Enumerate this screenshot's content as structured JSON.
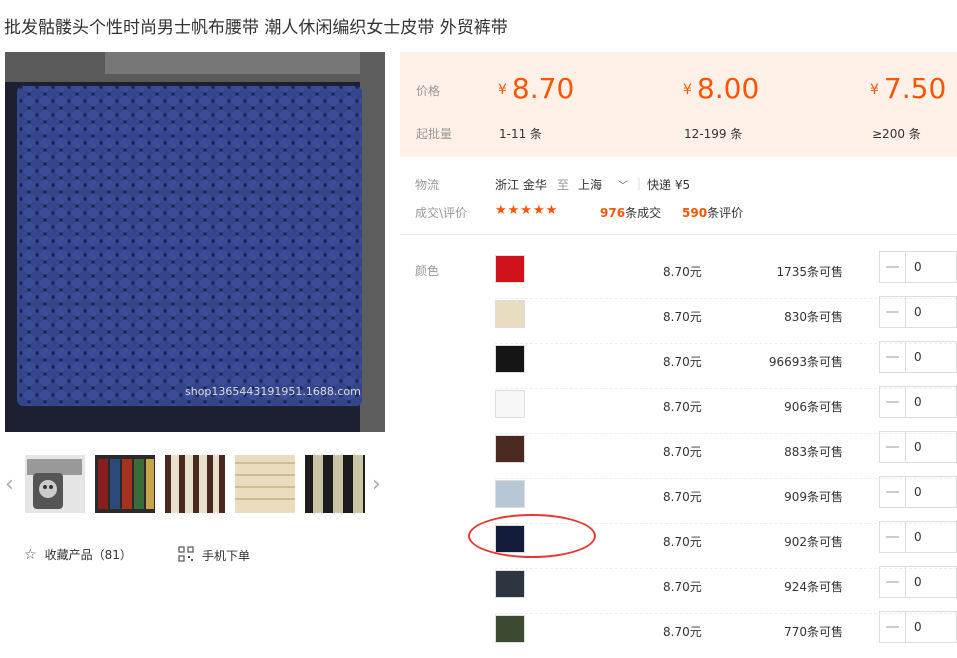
{
  "title": "批发骷髅头个性时尚男士帆布腰带 潮人休闲编织女士皮带 外贸裤带",
  "main_image": {
    "watermark": "shop1365443191951.1688.com"
  },
  "thumbnails": [
    {
      "name": "skull-buckle"
    },
    {
      "name": "stripe-samples"
    },
    {
      "name": "brown-stripe"
    },
    {
      "name": "beige-canvas"
    },
    {
      "name": "black-stripe"
    }
  ],
  "actions": {
    "favorite": "收藏产品（81）",
    "mobile": "手机下单"
  },
  "price": {
    "label_price": "价格",
    "label_batch": "起批量",
    "currency": "¥",
    "tiers": [
      {
        "price": "8.70",
        "qty": "1-11 条"
      },
      {
        "price": "8.00",
        "qty": "12-199 条"
      },
      {
        "price": "7.50",
        "qty": "≥200 条"
      }
    ]
  },
  "logistics": {
    "label": "物流",
    "from": "浙江 金华",
    "to_word": "至",
    "to": "上海",
    "shipping": "快递 ¥5"
  },
  "deals": {
    "label": "成交\\评价",
    "stars": "★★★★★",
    "deal_count": "976",
    "deal_unit": "条成交",
    "review_count": "590",
    "review_unit": "条评价"
  },
  "color_label": "颜色",
  "skus": [
    {
      "color": "#d0121b",
      "price": "8.70元",
      "stock": "1735条可售",
      "qty": "0"
    },
    {
      "color": "#e8dcc0",
      "price": "8.70元",
      "stock": "830条可售",
      "qty": "0"
    },
    {
      "color": "#151515",
      "price": "8.70元",
      "stock": "96693条可售",
      "qty": "0"
    },
    {
      "color": "#f7f7f7",
      "price": "8.70元",
      "stock": "906条可售",
      "qty": "0"
    },
    {
      "color": "#4a2a20",
      "price": "8.70元",
      "stock": "883条可售",
      "qty": "0"
    },
    {
      "color": "#b8c7d6",
      "price": "8.70元",
      "stock": "909条可售",
      "qty": "0"
    },
    {
      "color": "#141c3c",
      "price": "8.70元",
      "stock": "902条可售",
      "qty": "0"
    },
    {
      "color": "#2c3540",
      "price": "8.70元",
      "stock": "924条可售",
      "qty": "0"
    },
    {
      "color": "#3c4a32",
      "price": "8.70元",
      "stock": "770条可售",
      "qty": "0"
    }
  ],
  "accent_color": "#ff5500",
  "annotation_color": "#e53935"
}
